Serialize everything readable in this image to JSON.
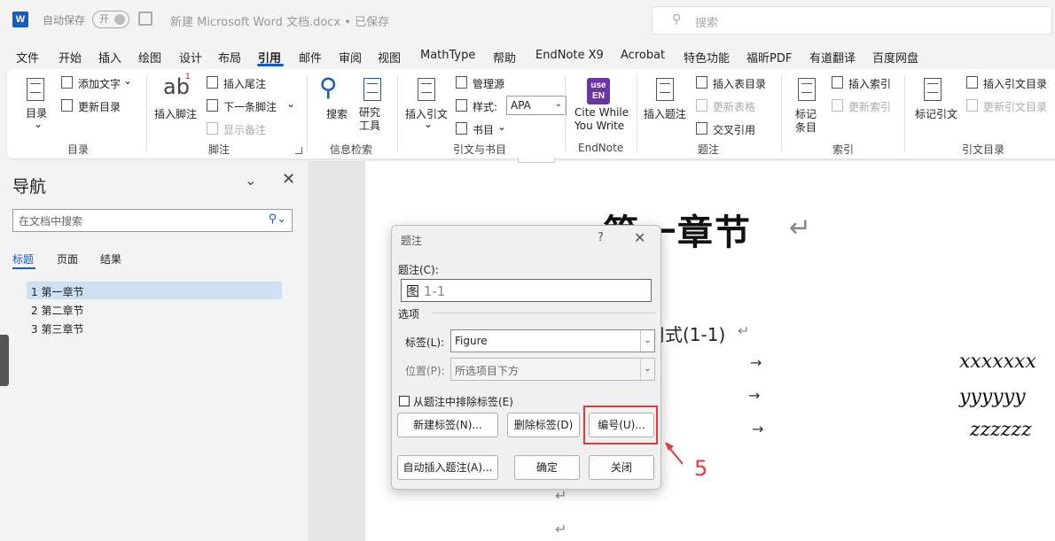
{
  "titlebar": {
    "autosave_label": "自动保存",
    "autosave_state": "开",
    "doc_title": "新建 Microsoft Word 文档.docx • 已保存",
    "search_placeholder": "搜索"
  },
  "menu": [
    "文件",
    "开始",
    "插入",
    "绘图",
    "设计",
    "布局",
    "引用",
    "邮件",
    "审阅",
    "视图",
    "MathType",
    "帮助",
    "EndNote X9",
    "Acrobat",
    "特色功能",
    "福昕PDF",
    "有道翻译",
    "百度网盘"
  ],
  "ribbon": {
    "toc": {
      "toc": "目录",
      "add_text": "添加文字",
      "update_toc": "更新目录",
      "group": "目录"
    },
    "footnotes": {
      "insert_footnote": "插入脚注",
      "insert_endnote": "插入尾注",
      "next_footnote": "下一条脚注",
      "show_notes": "显示备注",
      "group": "脚注"
    },
    "research": {
      "search": "搜索",
      "research_tools": "研究工具",
      "group": "信息检索"
    },
    "citations": {
      "insert_citation": "插入引文",
      "manage_sources": "管理源",
      "style_label": "样式:",
      "style_value": "APA",
      "bibliography": "书目",
      "group": "引文与书目"
    },
    "endnote": {
      "cite_line1": "Cite While",
      "cite_line2": "You Write",
      "group": "EndNote"
    },
    "captions": {
      "insert_caption": "插入题注",
      "insert_table_of_figures": "插入表目录",
      "update_table": "更新表格",
      "cross_reference": "交叉引用",
      "group": "题注"
    },
    "index": {
      "mark_entry_line1": "标记",
      "mark_entry_line2": "条目",
      "insert_index": "插入索引",
      "update_index": "更新索引",
      "group": "索引"
    },
    "toa": {
      "mark_citation": "标记引文",
      "insert_toa": "插入引文目录",
      "update_toa": "更新引文目录",
      "group": "引文目录"
    }
  },
  "nav": {
    "title": "导航",
    "search_placeholder": "在文档中搜索",
    "tabs": [
      "标题",
      "页面",
      "结果"
    ],
    "headings": [
      "1 第一章节",
      "2 第二章节",
      "3 第三章节"
    ]
  },
  "document": {
    "chapter_title": "第一章节",
    "formula_text": "用式(1-1)",
    "vars": [
      "xxxxxxx",
      "yyyyyy",
      "zzzzzz"
    ]
  },
  "dialog": {
    "title": "题注",
    "help": "?",
    "caption_label": "题注(C):",
    "caption_prefix": "图",
    "caption_number": "1-1",
    "options_label": "选项",
    "label_label": "标签(L):",
    "label_value": "Figure",
    "position_label": "位置(P):",
    "position_value": "所选项目下方",
    "exclude_label": "从题注中排除标签(E)",
    "new_label_btn": "新建标签(N)...",
    "delete_label_btn": "删除标签(D)",
    "numbering_btn": "编号(U)...",
    "autocaption_btn": "自动插入题注(A)...",
    "ok_btn": "确定",
    "close_btn": "关闭"
  },
  "annotation": {
    "step": "5",
    "color": "#e53935"
  },
  "colors": {
    "accent": "#185abd"
  }
}
